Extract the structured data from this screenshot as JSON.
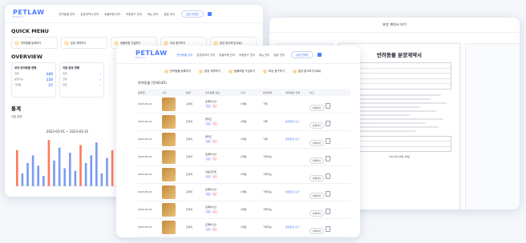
{
  "brand": {
    "logo_main": "PETLAW",
    "logo_sub": "BREAL"
  },
  "nav": [
    "반려동물 관리",
    "분양계약서 관리",
    "동물보험 관리",
    "보증청구 관리",
    "메뉴 관리",
    "설정 관리"
  ],
  "nav_short": [
    "반려동물 관리",
    "분양계약서 관리",
    "동물보험 관리",
    "보증청구 관리",
    "메뉴 관리",
    "설정 관리"
  ],
  "status_pill": "입점 판매업",
  "dashboard": {
    "quick_menu_title": "QUICK MENU",
    "quick_menu": [
      "반려동물 등록하기",
      "분양 계약하기",
      "동물보험 가입하기",
      "보상 청구하기",
      "분양 광고하기(무료)"
    ],
    "overview_title": "OVERVIEW",
    "overview": [
      {
        "title": "보유 반려동물 현황",
        "rows": [
          [
            "전체",
            "145"
          ],
          [
            "분양가능",
            "133"
          ],
          [
            "거래중",
            "17"
          ]
        ]
      },
      {
        "title": "이달 분양 현황",
        "rows": [
          [
            "계약",
            "-"
          ],
          [
            "진행",
            "-"
          ],
          [
            "완료",
            "-"
          ]
        ]
      }
    ],
    "stats_title": "통계",
    "chart_label": "이달 분양",
    "chart_range": "2023-03-01 ~ 2023-03-31"
  },
  "chart_data": {
    "type": "bar",
    "categories": [
      "1",
      "2",
      "3",
      "4",
      "5",
      "6",
      "7",
      "8",
      "9",
      "10",
      "11",
      "12",
      "13",
      "14",
      "15",
      "16",
      "17",
      "18",
      "19",
      "20"
    ],
    "values": [
      14,
      5,
      9,
      12,
      8,
      4,
      18,
      10,
      15,
      7,
      13,
      6,
      16,
      9,
      12,
      17,
      5,
      11,
      14,
      8
    ],
    "title": "",
    "xlabel": "",
    "ylabel": ""
  },
  "contract": {
    "header": "분양 계약서 보기",
    "doc_title": "반려동물 분양계약서",
    "doc_sub": "",
    "doc_date": "2023년 03월 18일"
  },
  "list": {
    "quick_menu": [
      "반려동물 등록하기",
      "분양 계약하기",
      "동물보험 가입하기",
      "보상 청구하기",
      "분양 광고하기(무료)"
    ],
    "heading": "반려동물 (전체145)",
    "columns": [
      "등록일",
      "사진",
      "분류",
      "반려동물 정보",
      "나이",
      "분양상태",
      "계약번호 연결",
      "비고",
      "",
      ""
    ],
    "rows": [
      {
        "date": "2023-03-01",
        "type": "강아지",
        "name": "포메라니안",
        "tag1": "수컷",
        "tag2": "1년",
        "age": "2개월",
        "status": "거래",
        "contract": "-",
        "note": "",
        "btn": "분양하기"
      },
      {
        "date": "2023-03-01",
        "type": "강아지",
        "name": "말티즈",
        "tag1": "수컷",
        "tag2": "1년",
        "age": "2개월",
        "status": "거래",
        "contract": "-",
        "note": "분양완료 보기",
        "btn": "분양하기"
      },
      {
        "date": "2023-03-01",
        "type": "강아지",
        "name": "말티즈",
        "tag1": "암컷",
        "tag2": "1년",
        "age": "2개월",
        "status": "거래",
        "contract": "-",
        "note": "분양완료 보기",
        "btn": "분양하기"
      },
      {
        "date": "2023-03-01",
        "type": "강아지",
        "name": "포메라니안",
        "tag1": "수컷",
        "tag2": "1년",
        "age": "2개월",
        "status": "거래가능",
        "contract": "-",
        "note": "",
        "btn": "분양하기"
      },
      {
        "date": "2023-03-01",
        "type": "강아지",
        "name": "비숑프리제",
        "tag1": "수컷",
        "tag2": "1년",
        "age": "2개월",
        "status": "거래가능",
        "contract": "-",
        "note": "",
        "btn": "분양하기"
      },
      {
        "date": "2023-03-01",
        "type": "강아지",
        "name": "포메라니안",
        "tag1": "암컷",
        "tag2": "1년",
        "age": "2개월",
        "status": "거래가능",
        "contract": "-",
        "note": "분양완료 보기",
        "btn": "분양하기"
      },
      {
        "date": "2023-03-01",
        "type": "강아지",
        "name": "포메라니안",
        "tag1": "수컷",
        "tag2": "1년",
        "age": "2개월",
        "status": "거래가능",
        "contract": "-",
        "note": "",
        "btn": "분양하기"
      },
      {
        "date": "2023-03-01",
        "type": "강아지",
        "name": "포메라니안",
        "tag1": "수컷",
        "tag2": "1년",
        "age": "2개월",
        "status": "거래가능",
        "contract": "-",
        "note": "분양완료 보기",
        "btn": "분양하기"
      }
    ]
  },
  "colors": {
    "accent": "#4d7cff",
    "tag_pink": "#ff5d84",
    "bar": "#7b9cf0",
    "bar_highlight": "#ff7a5c"
  }
}
